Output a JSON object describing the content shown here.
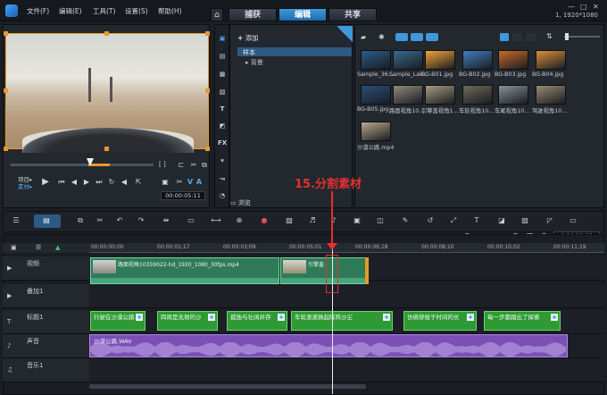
{
  "menu": {
    "file": "文件(F)",
    "edit": "编辑(E)",
    "tools": "工具(T)",
    "settings": "设置(S)",
    "help": "帮助(H)"
  },
  "tabs": {
    "capture": "捕获",
    "edit": "编辑",
    "share": "共享"
  },
  "resolution": "1, 1920*1080",
  "player": {
    "project_label": "项目▸",
    "clip_label": "素材▸",
    "timecode": "00:00:05:11",
    "zoom_label": "[ ]"
  },
  "library": {
    "add": "添加",
    "tree": [
      "样本",
      "背景"
    ],
    "browse": "浏览"
  },
  "media": [
    {
      "name": "Sample_36...",
      "color": "#2b5b8a"
    },
    {
      "name": "Sample_Lak...",
      "color": "#3a6a8f"
    },
    {
      "name": "BG-B01.jpg",
      "color": "#f0a33a"
    },
    {
      "name": "BG-B02.jpg",
      "color": "#3f7fbf"
    },
    {
      "name": "BG-B03.jpg",
      "color": "#c96a2a"
    },
    {
      "name": "BG-B04.jpg",
      "color": "#d88f3c"
    },
    {
      "name": "BG-B05.jpg",
      "color": "#2a4f7a"
    },
    {
      "name": "路面视角10...",
      "color": "#8f8a7a"
    },
    {
      "name": "引擎盖视角1...",
      "color": "#a89a80"
    },
    {
      "name": "车轮视角10...",
      "color": "#6f6a5a"
    },
    {
      "name": "车尾视角10...",
      "color": "#8a8f9a"
    },
    {
      "name": "驾驶视角10...",
      "color": "#9a8a70"
    },
    {
      "name": "沙漠公路.mp4",
      "color": "#b9a88a"
    }
  ],
  "timeline": {
    "timecode": "0:00:12:03",
    "ruler": [
      "00:00:00;00",
      "00:00:01;17",
      "00:00:03;09",
      "00:00:05;01",
      "00:00:06;18",
      "00:00:08;10",
      "00:00:10;02",
      "00:00:11;19"
    ],
    "tracks": [
      "视频",
      "叠加1",
      "标题1",
      "声音",
      "音乐1"
    ],
    "video_clips": [
      "路面视角10359022-hd_1920_1080_30fps.mp4",
      "引擎盖"
    ],
    "titles": [
      "行驶在沙漠公路",
      "四周是无垠的沙",
      "孤独与壮阔并存",
      "车轮滚滚扬起阵阵沙尘",
      "仿佛穿梭于时间的长",
      "每一步都踏出了探索"
    ],
    "audio": "沙漠公路.WAV"
  },
  "annotation": "15.分割素材"
}
